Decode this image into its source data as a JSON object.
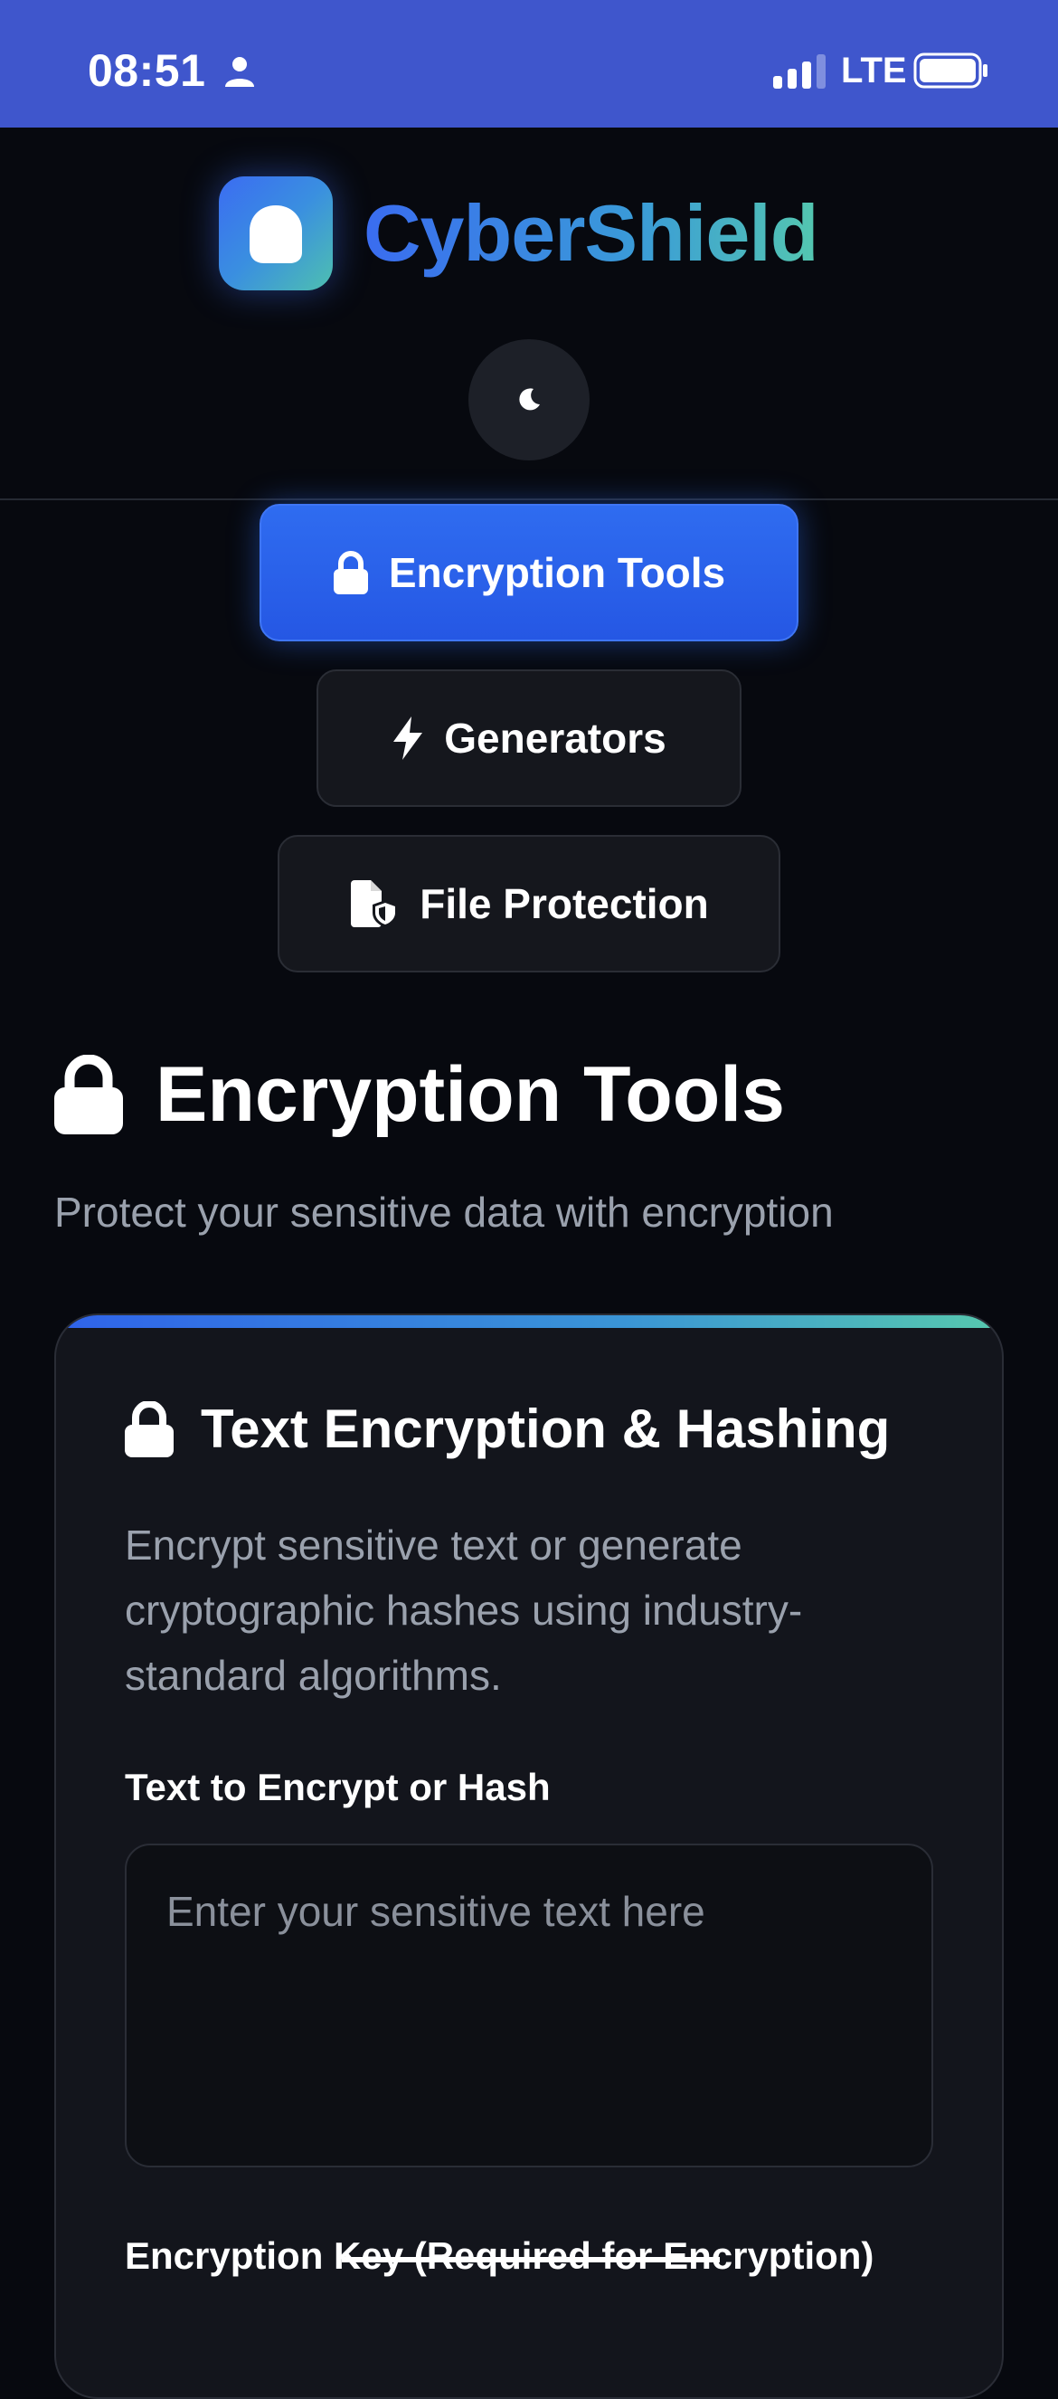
{
  "status_bar": {
    "time": "08:51",
    "network": "LTE"
  },
  "header": {
    "app_name": "CyberShield",
    "theme_icon": "moon-icon"
  },
  "nav": {
    "items": [
      {
        "label": "Encryption Tools",
        "icon": "lock-icon",
        "active": true
      },
      {
        "label": "Generators",
        "icon": "bolt-icon",
        "active": false
      },
      {
        "label": "File Protection",
        "icon": "file-shield-icon",
        "active": false
      }
    ]
  },
  "section": {
    "title": "Encryption Tools",
    "subtitle": "Protect your sensitive data with encryption"
  },
  "card": {
    "title": "Text Encryption & Hashing",
    "description": "Encrypt sensitive text or generate cryptographic hashes using industry-standard algorithms.",
    "text_label": "Text to Encrypt or Hash",
    "text_placeholder": "Enter your sensitive text here",
    "key_label": "Encryption Key (Required for Encryption)"
  },
  "colors": {
    "status_bar": "#3f56cc",
    "accent_blue": "#2f6cf0",
    "accent_teal": "#54c7b0",
    "background": "#07090f",
    "card": "#13151c"
  }
}
